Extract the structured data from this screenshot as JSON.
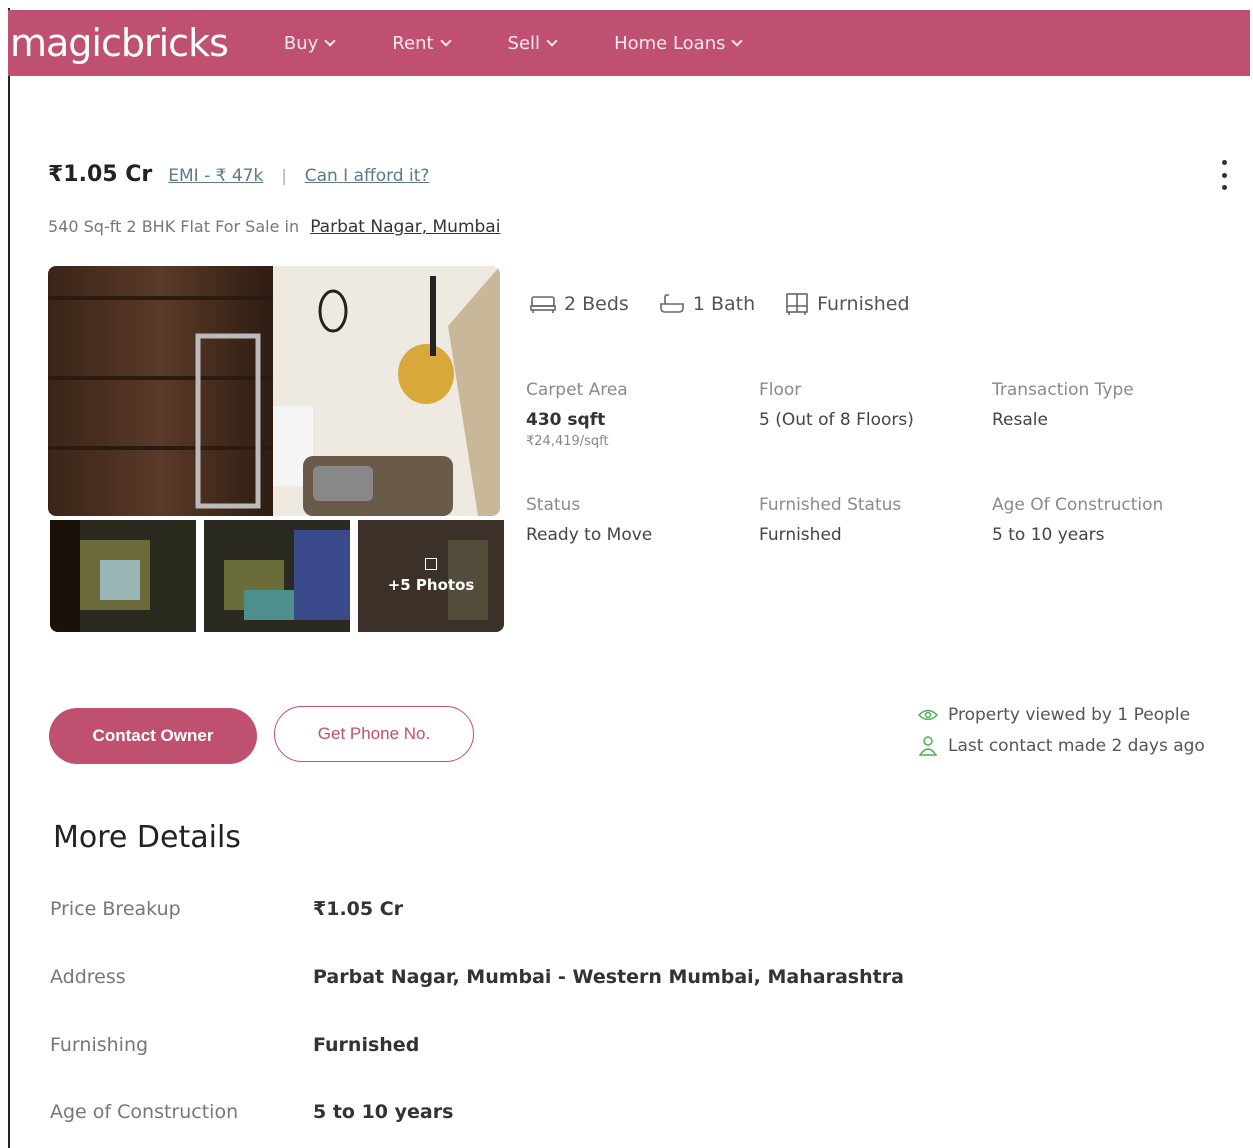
{
  "brand": {
    "logo": "magicbricks",
    "color": "#c0506f"
  },
  "nav": {
    "items": [
      "Buy",
      "Rent",
      "Sell",
      "Home Loans"
    ]
  },
  "listing": {
    "price": "₹1.05 Cr",
    "emi": "EMI - ₹ 47k",
    "afford_link": "Can I afford it?",
    "subtitle": "540 Sq-ft 2 BHK Flat For Sale in",
    "locality": "Parbat Nagar, Mumbai",
    "more_photos": "+5 Photos",
    "amenities": {
      "beds": "2 Beds",
      "bath": "1 Bath",
      "furnishing": "Furnished"
    },
    "specs": {
      "carpet_area_label": "Carpet Area",
      "carpet_area_value": "430 sqft",
      "carpet_area_rate": "₹24,419/sqft",
      "floor_label": "Floor",
      "floor_value": "5 (Out of 8 Floors)",
      "transaction_label": "Transaction Type",
      "transaction_value": "Resale",
      "status_label": "Status",
      "status_value": "Ready to Move",
      "furnished_status_label": "Furnished Status",
      "furnished_status_value": "Furnished",
      "age_label": "Age Of Construction",
      "age_value": "5 to 10 years"
    }
  },
  "actions": {
    "contact_owner": "Contact Owner",
    "get_phone": "Get Phone No."
  },
  "activity": {
    "viewed": "Property viewed by 1 People",
    "last_contact": "Last contact made 2 days ago"
  },
  "more_details": {
    "title": "More Details",
    "rows": [
      {
        "key": "Price Breakup",
        "value": "₹1.05 Cr"
      },
      {
        "key": "Address",
        "value": "Parbat Nagar, Mumbai - Western Mumbai, Maharashtra"
      },
      {
        "key": "Furnishing",
        "value": "Furnished"
      },
      {
        "key": "Age of Construction",
        "value": "5 to 10 years"
      }
    ]
  }
}
